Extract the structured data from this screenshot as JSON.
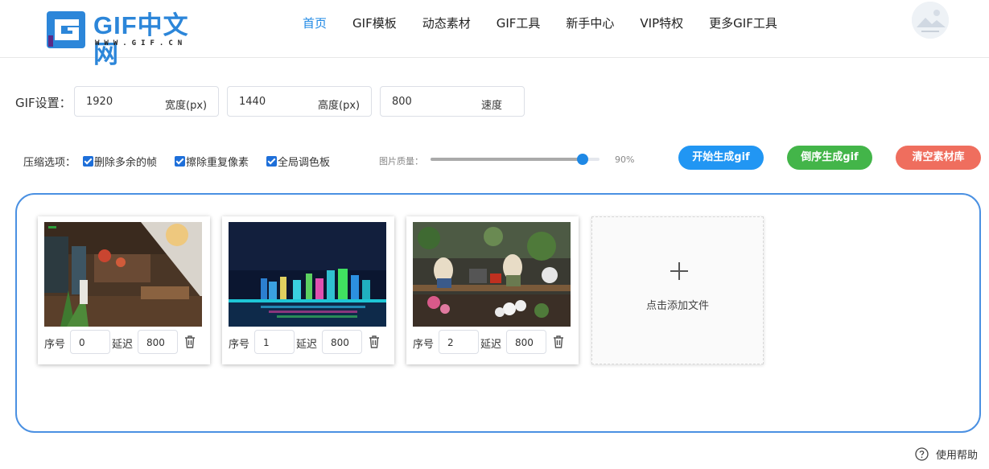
{
  "header": {
    "logo_text": "GIF中文网",
    "logo_sub": "WWW.GIF.CN",
    "nav": [
      {
        "label": "首页",
        "active": true
      },
      {
        "label": "GIF模板",
        "active": false
      },
      {
        "label": "动态素材",
        "active": false
      },
      {
        "label": "GIF工具",
        "active": false
      },
      {
        "label": "新手中心",
        "active": false
      },
      {
        "label": "VIP特权",
        "active": false
      },
      {
        "label": "更多GIF工具",
        "active": false
      }
    ],
    "avatar_icon": "user-avatar-placeholder"
  },
  "settings": {
    "label": "GIF设置：",
    "width_value": "1920",
    "width_unit": "宽度(px)",
    "height_value": "1440",
    "height_unit": "高度(px)",
    "speed_value": "800",
    "speed_unit": "速度"
  },
  "compress": {
    "label": "压缩选项：",
    "options": [
      {
        "label": "删除多余的帧",
        "checked": true
      },
      {
        "label": "擦除重复像素",
        "checked": true
      },
      {
        "label": "全局调色板",
        "checked": true
      }
    ],
    "quality_label": "图片质量：",
    "quality_percent": 90,
    "quality_text": "90%"
  },
  "actions": {
    "start": "开始生成gif",
    "reverse": "倒序生成gif",
    "clear": "清空素材库"
  },
  "frames": {
    "index_label": "序号",
    "delay_label": "延迟",
    "items": [
      {
        "index": "0",
        "delay": "800",
        "scene": "restaurant-interior"
      },
      {
        "index": "1",
        "delay": "800",
        "scene": "city-night-skyline"
      },
      {
        "index": "2",
        "delay": "800",
        "scene": "rabbit-figurines-flowers"
      }
    ]
  },
  "add_file": {
    "label": "点击添加文件"
  },
  "help": {
    "label": "使用帮助"
  },
  "colors": {
    "primary": "#1e88e5",
    "green": "#43b549",
    "red": "#ef6e5e",
    "border_blue": "#4a90e2"
  }
}
